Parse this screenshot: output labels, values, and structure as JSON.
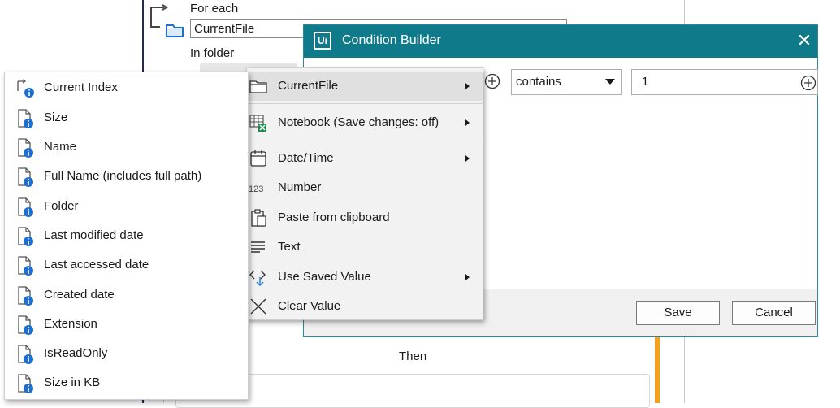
{
  "designer": {
    "foreach_label": "For each",
    "foreach_value": "CurrentFile",
    "infolder_label": "In folder",
    "then_label": "Then"
  },
  "dialog": {
    "title": "Condition Builder",
    "logo_text": "Ui",
    "close_glyph": "✕",
    "operator_value": "contains",
    "value_text": "1",
    "save_label": "Save",
    "cancel_label": "Cancel"
  },
  "menu": {
    "items": [
      {
        "label": "CurrentFile",
        "icon": "folder-icon",
        "submenu": true
      },
      {
        "label": "Notebook (Save changes: off)",
        "icon": "spreadsheet-icon",
        "submenu": true
      },
      {
        "label": "Date/Time",
        "icon": "calendar-icon",
        "submenu": true
      },
      {
        "label": "Number",
        "icon": "number-icon",
        "submenu": false
      },
      {
        "label": "Paste from clipboard",
        "icon": "clipboard-icon",
        "submenu": false
      },
      {
        "label": "Text",
        "icon": "text-icon",
        "submenu": false
      },
      {
        "label": "Use Saved Value",
        "icon": "saved-value-icon",
        "submenu": true
      },
      {
        "label": "Clear Value",
        "icon": "clear-icon",
        "submenu": false
      }
    ],
    "number_icon_text": "123"
  },
  "submenu": {
    "items": [
      {
        "label": "Current Index"
      },
      {
        "label": "Size"
      },
      {
        "label": "Name"
      },
      {
        "label": "Full Name (includes full path)"
      },
      {
        "label": "Folder"
      },
      {
        "label": "Last modified date"
      },
      {
        "label": "Last accessed date"
      },
      {
        "label": "Created date"
      },
      {
        "label": "Extension"
      },
      {
        "label": "IsReadOnly"
      },
      {
        "label": "Size in KB"
      }
    ]
  },
  "colors": {
    "accent": "#0f7a8a",
    "info_blue": "#1e6fd0",
    "orange": "#f7a01d"
  }
}
